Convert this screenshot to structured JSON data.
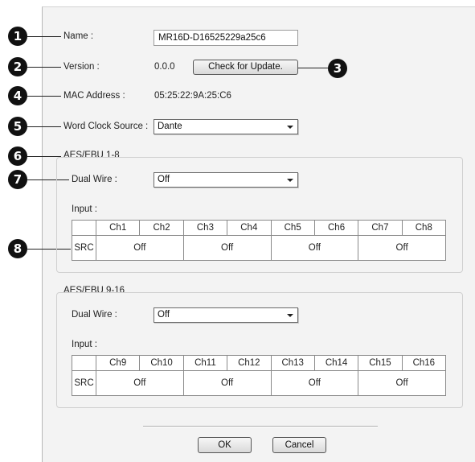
{
  "name_label": "Name :",
  "name_value": "MR16D-D16525229a25c6",
  "version_label": "Version :",
  "version_value": "0.0.0",
  "check_update_label": "Check for Update.",
  "mac_label": "MAC Address :",
  "mac_value": "05:25:22:9A:25:C6",
  "wordclock_label": "Word Clock Source :",
  "wordclock_value": "Dante",
  "callouts": [
    "1",
    "2",
    "3",
    "4",
    "5",
    "6",
    "7",
    "8"
  ],
  "aes1": {
    "title": "AES/EBU 1-8",
    "dual_wire_label": "Dual Wire :",
    "dual_wire_value": "Off",
    "input_label": "Input :",
    "channels": [
      "Ch1",
      "Ch2",
      "Ch3",
      "Ch4",
      "Ch5",
      "Ch6",
      "Ch7",
      "Ch8"
    ],
    "src_label": "SRC",
    "src_values": [
      "Off",
      "Off",
      "Off",
      "Off"
    ]
  },
  "aes2": {
    "title": "AES/EBU 9-16",
    "dual_wire_label": "Dual Wire :",
    "dual_wire_value": "Off",
    "input_label": "Input :",
    "channels": [
      "Ch9",
      "Ch10",
      "Ch11",
      "Ch12",
      "Ch13",
      "Ch14",
      "Ch15",
      "Ch16"
    ],
    "src_label": "SRC",
    "src_values": [
      "Off",
      "Off",
      "Off",
      "Off"
    ]
  },
  "ok_label": "OK",
  "cancel_label": "Cancel"
}
